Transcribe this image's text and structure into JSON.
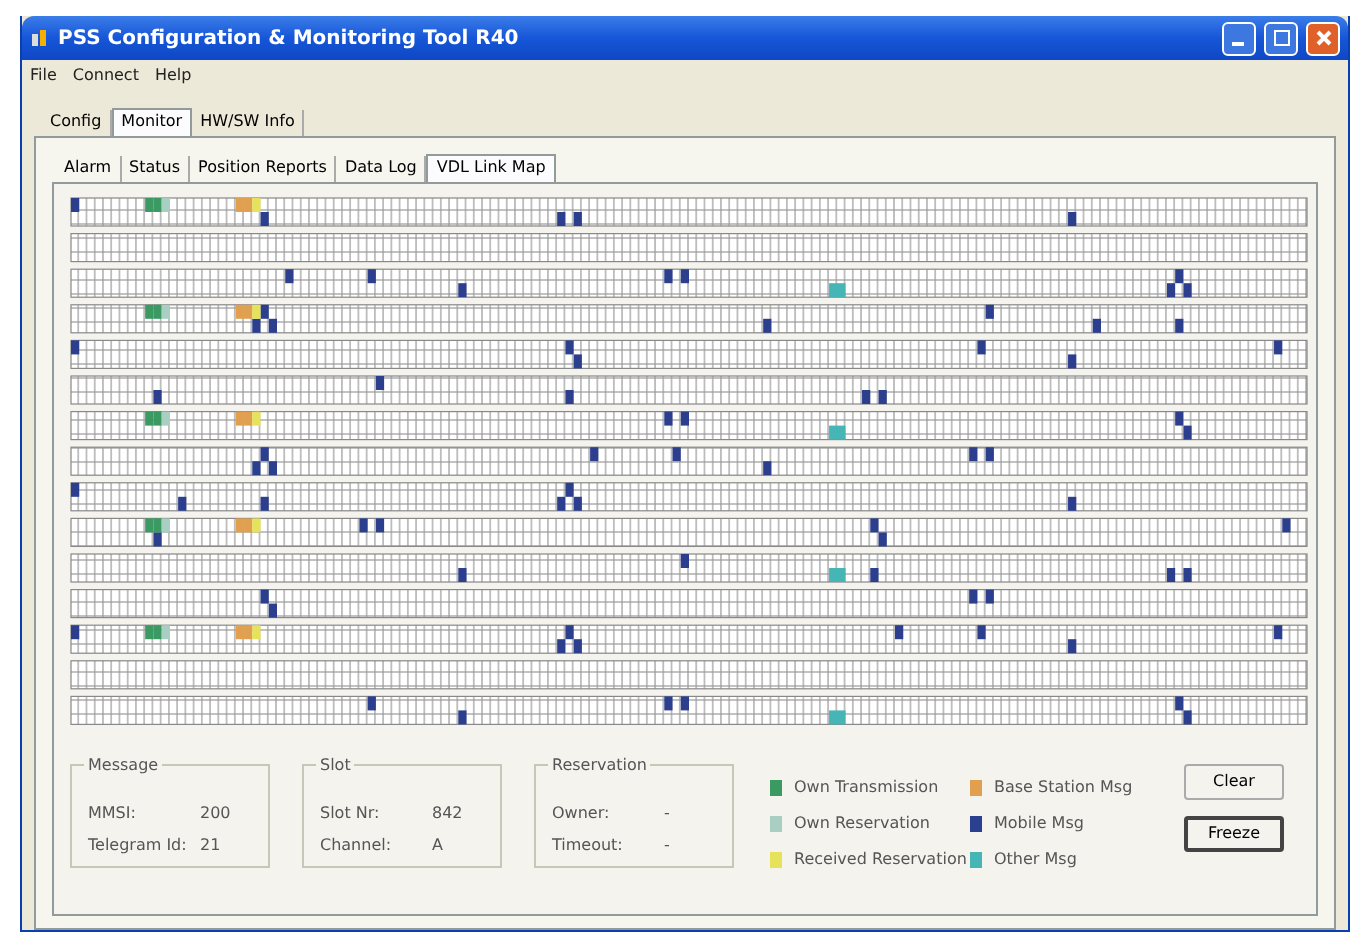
{
  "window": {
    "title": "PSS Configuration & Monitoring Tool R40"
  },
  "menu": [
    "File",
    "Connect",
    "Help"
  ],
  "tabs": [
    {
      "label": "Config",
      "selected": false
    },
    {
      "label": "Monitor",
      "selected": true
    },
    {
      "label": "HW/SW Info",
      "selected": false
    }
  ],
  "subtabs": [
    {
      "label": "Alarm",
      "selected": false
    },
    {
      "label": "Status",
      "selected": false
    },
    {
      "label": "Position Reports",
      "selected": false
    },
    {
      "label": "Data Log",
      "selected": false
    },
    {
      "label": "VDL Link Map",
      "selected": true
    }
  ],
  "groups": [
    {
      "title": "Message",
      "fields": [
        {
          "label": "MMSI:",
          "value": "200"
        },
        {
          "label": "Telegram Id:",
          "value": "21"
        }
      ]
    },
    {
      "title": "Slot",
      "fields": [
        {
          "label": "Slot Nr:",
          "value": "842"
        },
        {
          "label": "Channel:",
          "value": "A"
        }
      ]
    },
    {
      "title": "Reservation",
      "fields": [
        {
          "label": "Owner:",
          "value": "-"
        },
        {
          "label": "Timeout:",
          "value": "-"
        }
      ]
    }
  ],
  "legend": [
    {
      "label": "Own Transmission",
      "color": "#3a9a62"
    },
    {
      "label": "Own Reservation",
      "color": "#a9cfc2"
    },
    {
      "label": "Received Reservation",
      "color": "#e6e25a"
    },
    {
      "label": "Base Station Msg",
      "color": "#e0a050"
    },
    {
      "label": "Mobile Msg",
      "color": "#2c3f8f"
    },
    {
      "label": "Other Msg",
      "color": "#45b5b5"
    }
  ],
  "buttons": [
    {
      "label": "Clear",
      "default": false
    },
    {
      "label": "Freeze",
      "default": true
    }
  ]
}
